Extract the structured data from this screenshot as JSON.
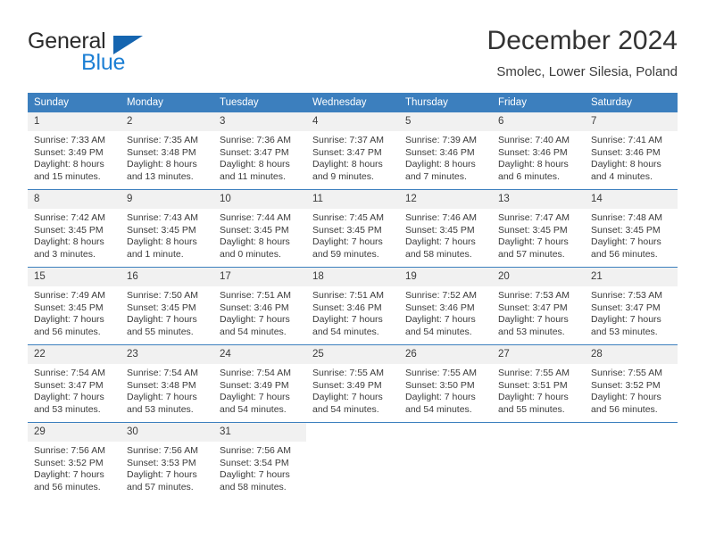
{
  "brand": {
    "name_top": "General",
    "name_bottom": "Blue",
    "accent_color": "#1c7fd4",
    "triangle_color": "#1565b0"
  },
  "header": {
    "title": "December 2024",
    "subtitle": "Smolec, Lower Silesia, Poland"
  },
  "theme": {
    "header_blue": "#3c7fbe",
    "daynum_gray": "#f1f1f1",
    "text": "#3b3b3b"
  },
  "calendar": {
    "day_headers": [
      "Sunday",
      "Monday",
      "Tuesday",
      "Wednesday",
      "Thursday",
      "Friday",
      "Saturday"
    ],
    "weeks": [
      [
        {
          "day": "1",
          "sunrise": "Sunrise: 7:33 AM",
          "sunset": "Sunset: 3:49 PM",
          "daylight_line1": "Daylight: 8 hours",
          "daylight_line2": "and 15 minutes."
        },
        {
          "day": "2",
          "sunrise": "Sunrise: 7:35 AM",
          "sunset": "Sunset: 3:48 PM",
          "daylight_line1": "Daylight: 8 hours",
          "daylight_line2": "and 13 minutes."
        },
        {
          "day": "3",
          "sunrise": "Sunrise: 7:36 AM",
          "sunset": "Sunset: 3:47 PM",
          "daylight_line1": "Daylight: 8 hours",
          "daylight_line2": "and 11 minutes."
        },
        {
          "day": "4",
          "sunrise": "Sunrise: 7:37 AM",
          "sunset": "Sunset: 3:47 PM",
          "daylight_line1": "Daylight: 8 hours",
          "daylight_line2": "and 9 minutes."
        },
        {
          "day": "5",
          "sunrise": "Sunrise: 7:39 AM",
          "sunset": "Sunset: 3:46 PM",
          "daylight_line1": "Daylight: 8 hours",
          "daylight_line2": "and 7 minutes."
        },
        {
          "day": "6",
          "sunrise": "Sunrise: 7:40 AM",
          "sunset": "Sunset: 3:46 PM",
          "daylight_line1": "Daylight: 8 hours",
          "daylight_line2": "and 6 minutes."
        },
        {
          "day": "7",
          "sunrise": "Sunrise: 7:41 AM",
          "sunset": "Sunset: 3:46 PM",
          "daylight_line1": "Daylight: 8 hours",
          "daylight_line2": "and 4 minutes."
        }
      ],
      [
        {
          "day": "8",
          "sunrise": "Sunrise: 7:42 AM",
          "sunset": "Sunset: 3:45 PM",
          "daylight_line1": "Daylight: 8 hours",
          "daylight_line2": "and 3 minutes."
        },
        {
          "day": "9",
          "sunrise": "Sunrise: 7:43 AM",
          "sunset": "Sunset: 3:45 PM",
          "daylight_line1": "Daylight: 8 hours",
          "daylight_line2": "and 1 minute."
        },
        {
          "day": "10",
          "sunrise": "Sunrise: 7:44 AM",
          "sunset": "Sunset: 3:45 PM",
          "daylight_line1": "Daylight: 8 hours",
          "daylight_line2": "and 0 minutes."
        },
        {
          "day": "11",
          "sunrise": "Sunrise: 7:45 AM",
          "sunset": "Sunset: 3:45 PM",
          "daylight_line1": "Daylight: 7 hours",
          "daylight_line2": "and 59 minutes."
        },
        {
          "day": "12",
          "sunrise": "Sunrise: 7:46 AM",
          "sunset": "Sunset: 3:45 PM",
          "daylight_line1": "Daylight: 7 hours",
          "daylight_line2": "and 58 minutes."
        },
        {
          "day": "13",
          "sunrise": "Sunrise: 7:47 AM",
          "sunset": "Sunset: 3:45 PM",
          "daylight_line1": "Daylight: 7 hours",
          "daylight_line2": "and 57 minutes."
        },
        {
          "day": "14",
          "sunrise": "Sunrise: 7:48 AM",
          "sunset": "Sunset: 3:45 PM",
          "daylight_line1": "Daylight: 7 hours",
          "daylight_line2": "and 56 minutes."
        }
      ],
      [
        {
          "day": "15",
          "sunrise": "Sunrise: 7:49 AM",
          "sunset": "Sunset: 3:45 PM",
          "daylight_line1": "Daylight: 7 hours",
          "daylight_line2": "and 56 minutes."
        },
        {
          "day": "16",
          "sunrise": "Sunrise: 7:50 AM",
          "sunset": "Sunset: 3:45 PM",
          "daylight_line1": "Daylight: 7 hours",
          "daylight_line2": "and 55 minutes."
        },
        {
          "day": "17",
          "sunrise": "Sunrise: 7:51 AM",
          "sunset": "Sunset: 3:46 PM",
          "daylight_line1": "Daylight: 7 hours",
          "daylight_line2": "and 54 minutes."
        },
        {
          "day": "18",
          "sunrise": "Sunrise: 7:51 AM",
          "sunset": "Sunset: 3:46 PM",
          "daylight_line1": "Daylight: 7 hours",
          "daylight_line2": "and 54 minutes."
        },
        {
          "day": "19",
          "sunrise": "Sunrise: 7:52 AM",
          "sunset": "Sunset: 3:46 PM",
          "daylight_line1": "Daylight: 7 hours",
          "daylight_line2": "and 54 minutes."
        },
        {
          "day": "20",
          "sunrise": "Sunrise: 7:53 AM",
          "sunset": "Sunset: 3:47 PM",
          "daylight_line1": "Daylight: 7 hours",
          "daylight_line2": "and 53 minutes."
        },
        {
          "day": "21",
          "sunrise": "Sunrise: 7:53 AM",
          "sunset": "Sunset: 3:47 PM",
          "daylight_line1": "Daylight: 7 hours",
          "daylight_line2": "and 53 minutes."
        }
      ],
      [
        {
          "day": "22",
          "sunrise": "Sunrise: 7:54 AM",
          "sunset": "Sunset: 3:47 PM",
          "daylight_line1": "Daylight: 7 hours",
          "daylight_line2": "and 53 minutes."
        },
        {
          "day": "23",
          "sunrise": "Sunrise: 7:54 AM",
          "sunset": "Sunset: 3:48 PM",
          "daylight_line1": "Daylight: 7 hours",
          "daylight_line2": "and 53 minutes."
        },
        {
          "day": "24",
          "sunrise": "Sunrise: 7:54 AM",
          "sunset": "Sunset: 3:49 PM",
          "daylight_line1": "Daylight: 7 hours",
          "daylight_line2": "and 54 minutes."
        },
        {
          "day": "25",
          "sunrise": "Sunrise: 7:55 AM",
          "sunset": "Sunset: 3:49 PM",
          "daylight_line1": "Daylight: 7 hours",
          "daylight_line2": "and 54 minutes."
        },
        {
          "day": "26",
          "sunrise": "Sunrise: 7:55 AM",
          "sunset": "Sunset: 3:50 PM",
          "daylight_line1": "Daylight: 7 hours",
          "daylight_line2": "and 54 minutes."
        },
        {
          "day": "27",
          "sunrise": "Sunrise: 7:55 AM",
          "sunset": "Sunset: 3:51 PM",
          "daylight_line1": "Daylight: 7 hours",
          "daylight_line2": "and 55 minutes."
        },
        {
          "day": "28",
          "sunrise": "Sunrise: 7:55 AM",
          "sunset": "Sunset: 3:52 PM",
          "daylight_line1": "Daylight: 7 hours",
          "daylight_line2": "and 56 minutes."
        }
      ],
      [
        {
          "day": "29",
          "sunrise": "Sunrise: 7:56 AM",
          "sunset": "Sunset: 3:52 PM",
          "daylight_line1": "Daylight: 7 hours",
          "daylight_line2": "and 56 minutes."
        },
        {
          "day": "30",
          "sunrise": "Sunrise: 7:56 AM",
          "sunset": "Sunset: 3:53 PM",
          "daylight_line1": "Daylight: 7 hours",
          "daylight_line2": "and 57 minutes."
        },
        {
          "day": "31",
          "sunrise": "Sunrise: 7:56 AM",
          "sunset": "Sunset: 3:54 PM",
          "daylight_line1": "Daylight: 7 hours",
          "daylight_line2": "and 58 minutes."
        },
        {
          "day": "",
          "sunrise": "",
          "sunset": "",
          "daylight_line1": "",
          "daylight_line2": ""
        },
        {
          "day": "",
          "sunrise": "",
          "sunset": "",
          "daylight_line1": "",
          "daylight_line2": ""
        },
        {
          "day": "",
          "sunrise": "",
          "sunset": "",
          "daylight_line1": "",
          "daylight_line2": ""
        },
        {
          "day": "",
          "sunrise": "",
          "sunset": "",
          "daylight_line1": "",
          "daylight_line2": ""
        }
      ]
    ]
  }
}
